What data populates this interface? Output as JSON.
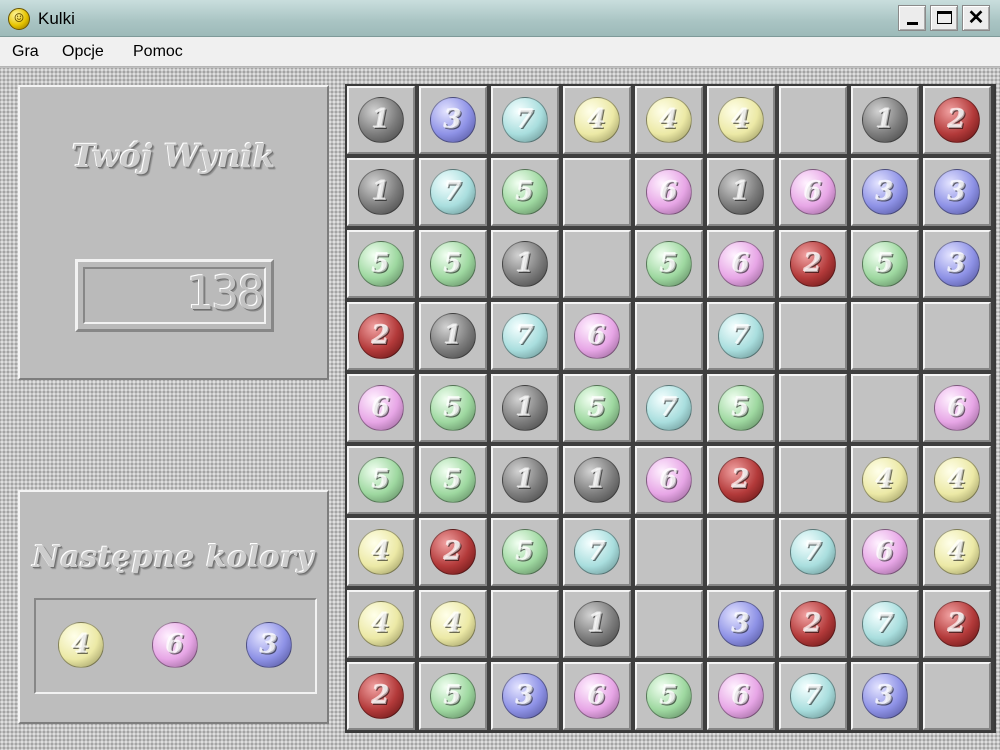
{
  "window": {
    "title": "Kulki"
  },
  "menu": [
    "Gra",
    "Opcje",
    "Pomoc"
  ],
  "score_panel": {
    "title": "Twój Wynik",
    "score": "138"
  },
  "next_panel": {
    "title": "Następne kolory",
    "next_balls": [
      4,
      6,
      3
    ]
  },
  "ball_colors": {
    "1": "#7c7c7c",
    "2": "#b33a3a",
    "3": "#8e92e6",
    "4": "#ece9a6",
    "5": "#9ed8a0",
    "6": "#e7a6e6",
    "7": "#a9dede"
  },
  "board": {
    "rows": 9,
    "cols": 9,
    "cells": [
      [
        1,
        3,
        7,
        4,
        4,
        4,
        0,
        1,
        2
      ],
      [
        1,
        7,
        5,
        0,
        6,
        1,
        6,
        3,
        3
      ],
      [
        5,
        5,
        1,
        0,
        5,
        6,
        2,
        5,
        3
      ],
      [
        2,
        1,
        7,
        6,
        0,
        7,
        0,
        0,
        0
      ],
      [
        6,
        5,
        1,
        5,
        7,
        5,
        0,
        0,
        6
      ],
      [
        5,
        5,
        1,
        1,
        6,
        2,
        0,
        4,
        4
      ],
      [
        4,
        2,
        5,
        7,
        0,
        0,
        7,
        6,
        4
      ],
      [
        4,
        4,
        0,
        1,
        0,
        3,
        2,
        7,
        2
      ],
      [
        2,
        5,
        3,
        6,
        5,
        6,
        7,
        3,
        0
      ]
    ]
  }
}
